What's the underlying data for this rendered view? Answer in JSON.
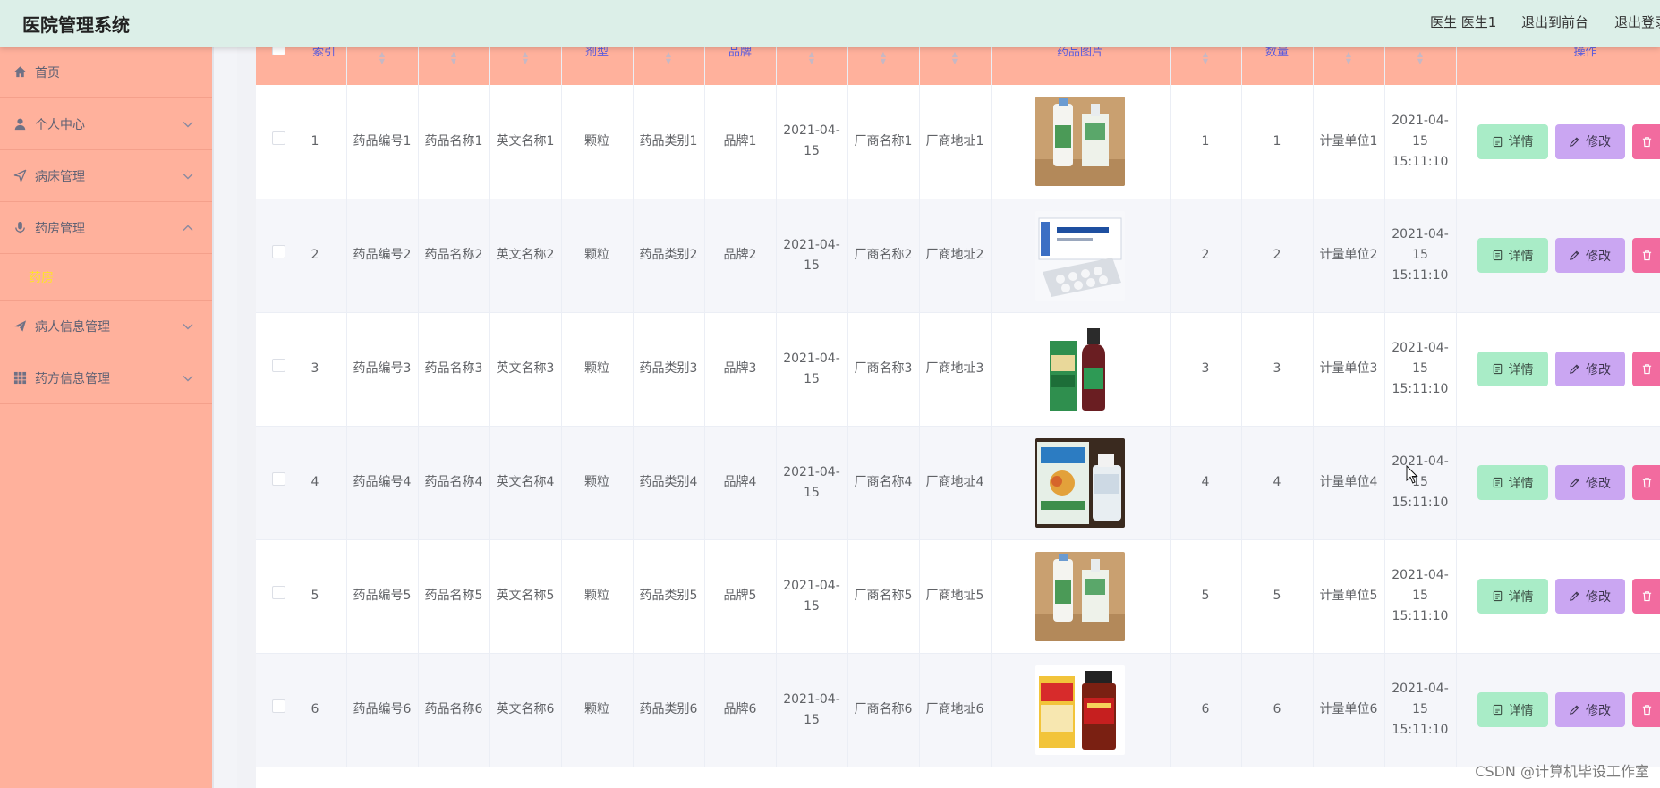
{
  "app": {
    "title": "医院管理系统"
  },
  "header": {
    "user_label": "医生 医生1",
    "front_label": "退出到前台",
    "logout_label": "退出登录"
  },
  "sidebar": {
    "items": [
      {
        "label": "首页",
        "icon": "home-icon"
      },
      {
        "label": "个人中心",
        "icon": "user-icon"
      },
      {
        "label": "病床管理",
        "icon": "send-icon"
      },
      {
        "label": "药房管理",
        "icon": "microphone-icon",
        "sub": "药房"
      },
      {
        "label": "病人信息管理",
        "icon": "paper-plane-icon"
      },
      {
        "label": "药方信息管理",
        "icon": "grid-icon"
      }
    ]
  },
  "table": {
    "headers": {
      "index": "索引",
      "form": "剂型",
      "brand": "品牌",
      "image": "药品图片",
      "count": "数量",
      "ops": "操作"
    },
    "rows": [
      {
        "index": "1",
        "code": "药品编号1",
        "name": "药品名称1",
        "en": "英文名称1",
        "form": "颗粒",
        "cat": "药品类别1",
        "brand": "品牌1",
        "date": "2021-04-15",
        "maker": "厂商名称1",
        "addr": "厂商地址1",
        "stock": "1",
        "count": "1",
        "unit": "计量单位1",
        "time": "2021-04-15 15:11:10"
      },
      {
        "index": "2",
        "code": "药品编号2",
        "name": "药品名称2",
        "en": "英文名称2",
        "form": "颗粒",
        "cat": "药品类别2",
        "brand": "品牌2",
        "date": "2021-04-15",
        "maker": "厂商名称2",
        "addr": "厂商地址2",
        "stock": "2",
        "count": "2",
        "unit": "计量单位2",
        "time": "2021-04-15 15:11:10"
      },
      {
        "index": "3",
        "code": "药品编号3",
        "name": "药品名称3",
        "en": "英文名称3",
        "form": "颗粒",
        "cat": "药品类别3",
        "brand": "品牌3",
        "date": "2021-04-15",
        "maker": "厂商名称3",
        "addr": "厂商地址3",
        "stock": "3",
        "count": "3",
        "unit": "计量单位3",
        "time": "2021-04-15 15:11:10"
      },
      {
        "index": "4",
        "code": "药品编号4",
        "name": "药品名称4",
        "en": "英文名称4",
        "form": "颗粒",
        "cat": "药品类别4",
        "brand": "品牌4",
        "date": "2021-04-15",
        "maker": "厂商名称4",
        "addr": "厂商地址4",
        "stock": "4",
        "count": "4",
        "unit": "计量单位4",
        "time": "2021-04-15 15:11:10"
      },
      {
        "index": "5",
        "code": "药品编号5",
        "name": "药品名称5",
        "en": "英文名称5",
        "form": "颗粒",
        "cat": "药品类别5",
        "brand": "品牌5",
        "date": "2021-04-15",
        "maker": "厂商名称5",
        "addr": "厂商地址5",
        "stock": "5",
        "count": "5",
        "unit": "计量单位5",
        "time": "2021-04-15 15:11:10"
      },
      {
        "index": "6",
        "code": "药品编号6",
        "name": "药品名称6",
        "en": "英文名称6",
        "form": "颗粒",
        "cat": "药品类别6",
        "brand": "品牌6",
        "date": "2021-04-15",
        "maker": "厂商名称6",
        "addr": "厂商地址6",
        "stock": "6",
        "count": "6",
        "unit": "计量单位6",
        "time": "2021-04-15 15:11:10"
      }
    ],
    "buttons": {
      "detail": "详情",
      "edit": "修改"
    }
  },
  "colors": {
    "sidebar": "#ffb19c",
    "header": "#dcefe8",
    "detail_button": "#a9ecc7",
    "edit_button": "#caa6f2",
    "delete_button": "#f26b9f",
    "active_submenu": "#ffe32a"
  },
  "watermark": "CSDN @计算机毕设工作室"
}
